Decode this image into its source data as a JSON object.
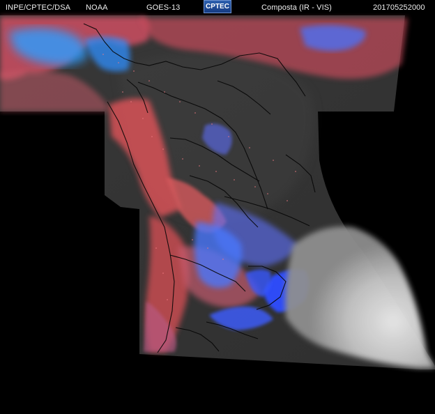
{
  "header": {
    "agency": "INPE/CPTEC/DSA",
    "partner": "NOAA",
    "satellite": "GOES-13",
    "logo": "CPTEC",
    "product": "Composta (IR - VIS)",
    "timestamp": "201705252000"
  },
  "colors": {
    "background": "#000000",
    "land": "#3b3b3b",
    "low_cloud": "#d9585b",
    "high_cloud": "#3f63ff",
    "visible_cloud": "#d7d7d7",
    "borders": "#000000"
  }
}
